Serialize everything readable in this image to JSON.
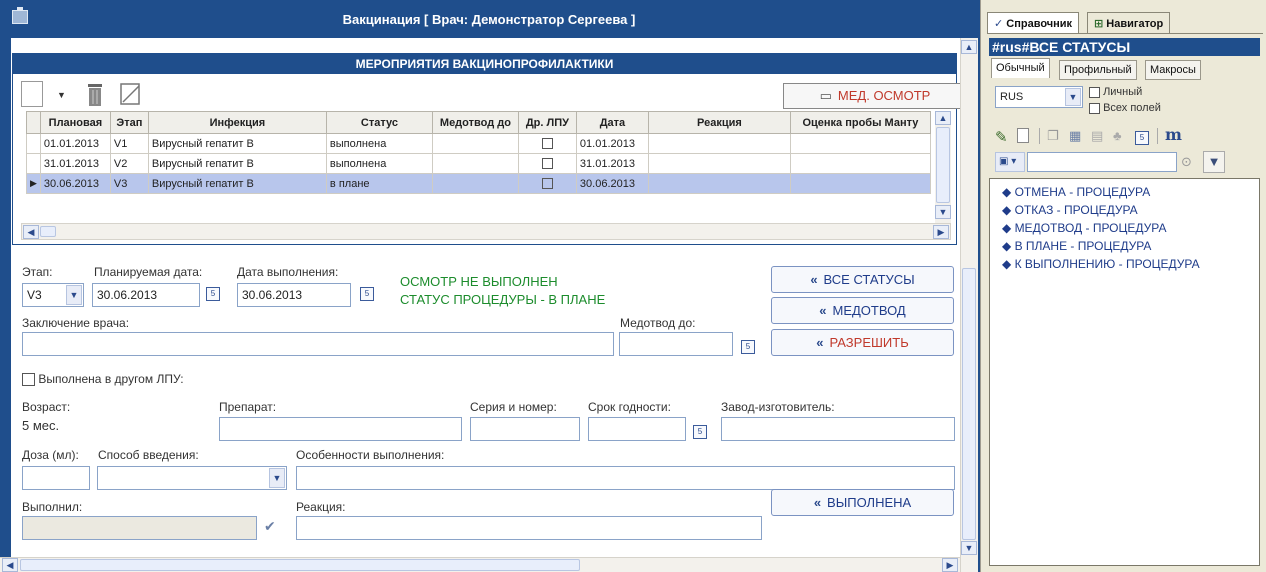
{
  "window": {
    "title": "Вакцинация  [ Врач: Демонстратор Сергеева ]"
  },
  "panel": {
    "title": "МЕРОПРИЯТИЯ ВАКЦИНОПРОФИЛАКТИКИ",
    "med_button": "МЕД. ОСМОТР"
  },
  "grid": {
    "headers": [
      "Плановая",
      "Этап",
      "Инфекция",
      "Статус",
      "Медотвод до",
      "Др. ЛПУ",
      "Дата",
      "Реакция",
      "Оценка пробы Манту"
    ],
    "rows": [
      {
        "plan": "01.01.2013",
        "stage": "V1",
        "infection": "Вирусный гепатит В",
        "status": "выполнена",
        "medotvod": "",
        "other": false,
        "date": "01.01.2013",
        "reaction": "",
        "mantu": ""
      },
      {
        "plan": "31.01.2013",
        "stage": "V2",
        "infection": "Вирусный гепатит В",
        "status": "выполнена",
        "medotvod": "",
        "other": false,
        "date": "31.01.2013",
        "reaction": "",
        "mantu": ""
      },
      {
        "plan": "30.06.2013",
        "stage": "V3",
        "infection": "Вирусный гепатит В",
        "status": "в плане",
        "medotvod": "",
        "other": false,
        "date": "30.06.2013",
        "reaction": "",
        "mantu": ""
      }
    ]
  },
  "form": {
    "stage_label": "Этап:",
    "stage_value": "V3",
    "plan_date_label": "Планируемая дата:",
    "plan_date_value": "30.06.2013",
    "done_date_label": "Дата выполнения:",
    "done_date_value": "30.06.2013",
    "status_line1": "ОСМОТР НЕ ВЫПОЛНЕН",
    "status_line2": "СТАТУС ПРОЦЕДУРЫ - В ПЛАНЕ",
    "conclusion_label": "Заключение врача:",
    "medotvod_label": "Медотвод до:",
    "other_lpu_label": "Выполнена в другом ЛПУ:",
    "age_label": "Возраст:",
    "age_value": "5 мес.",
    "drug_label": "Препарат:",
    "series_label": "Серия и номер:",
    "expiry_label": "Срок годности:",
    "maker_label": "Завод-изготовитель:",
    "dose_label": "Доза (мл):",
    "method_label": "Способ введения:",
    "features_label": "Особенности выполнения:",
    "executor_label": "Выполнил:",
    "reaction_label": "Реакция:"
  },
  "buttons": {
    "all_statuses": "ВСЕ СТАТУСЫ",
    "medotvod": "МЕДОТВОД",
    "allow": "РАЗРЕШИТЬ",
    "done": "ВЫПОЛНЕНА"
  },
  "right": {
    "tab_ref": "Справочник",
    "tab_nav": "Навигатор",
    "title": "#rus#ВСЕ СТАТУСЫ",
    "subtabs": [
      "Обычный",
      "Профильный",
      "Макросы"
    ],
    "lang": "RUS",
    "chk_personal": "Личный",
    "chk_all_fields": "Всех полей",
    "items": [
      "ОТМЕНА - ПРОЦЕДУРА",
      "ОТКАЗ - ПРОЦЕДУРА",
      "МЕДОТВОД - ПРОЦЕДУРА",
      "В ПЛАНЕ - ПРОЦЕДУРА",
      "К ВЫПОЛНЕНИЮ - ПРОЦЕДУРА"
    ]
  },
  "colors": {
    "frame": "#1f4e8c",
    "selected_row": "#b8c6ec",
    "status_green": "#1c8c2c",
    "accent_red": "#c0392b"
  }
}
